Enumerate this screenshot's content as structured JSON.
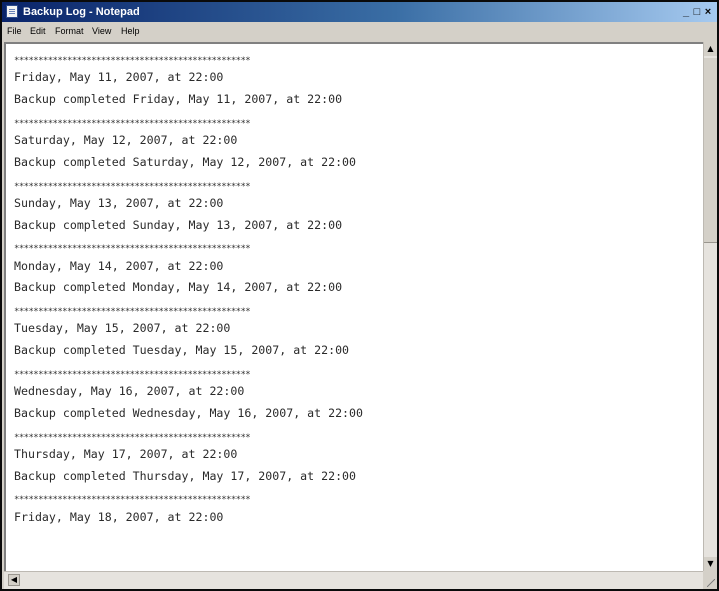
{
  "window": {
    "title": "Backup Log - Notepad",
    "minimize_label": "_",
    "maximize_label": "□",
    "close_label": "×"
  },
  "menu": {
    "items": [
      {
        "label": "File"
      },
      {
        "label": "Edit"
      },
      {
        "label": "Format"
      },
      {
        "label": "View"
      },
      {
        "label": "Help"
      }
    ]
  },
  "document": {
    "lines": [
      {
        "kind": "sep",
        "text": "*************************************************"
      },
      {
        "kind": "text",
        "text": "Friday, May 11, 2007, at 22:00"
      },
      {
        "kind": "text",
        "text": "Backup completed Friday, May 11, 2007, at 22:00"
      },
      {
        "kind": "gap",
        "text": ""
      },
      {
        "kind": "sep",
        "text": "*************************************************"
      },
      {
        "kind": "text",
        "text": "Saturday, May 12, 2007, at 22:00"
      },
      {
        "kind": "text",
        "text": "Backup completed Saturday, May 12, 2007, at 22:00"
      },
      {
        "kind": "gap",
        "text": ""
      },
      {
        "kind": "sep",
        "text": "*************************************************"
      },
      {
        "kind": "text",
        "text": "Sunday, May 13, 2007, at 22:00"
      },
      {
        "kind": "text",
        "text": "Backup completed Sunday, May 13, 2007, at 22:00"
      },
      {
        "kind": "gap",
        "text": ""
      },
      {
        "kind": "sep",
        "text": "*************************************************"
      },
      {
        "kind": "text",
        "text": "Monday, May 14, 2007, at 22:00"
      },
      {
        "kind": "text",
        "text": "Backup completed Monday, May 14, 2007, at 22:00"
      },
      {
        "kind": "gap",
        "text": ""
      },
      {
        "kind": "sep",
        "text": "*************************************************"
      },
      {
        "kind": "text",
        "text": "Tuesday, May 15, 2007, at 22:00"
      },
      {
        "kind": "text",
        "text": "Backup completed Tuesday, May 15, 2007, at 22:00"
      },
      {
        "kind": "gap",
        "text": ""
      },
      {
        "kind": "sep",
        "text": "*************************************************"
      },
      {
        "kind": "text",
        "text": "Wednesday, May 16, 2007, at 22:00"
      },
      {
        "kind": "text",
        "text": "Backup completed Wednesday, May 16, 2007, at 22:00"
      },
      {
        "kind": "gap",
        "text": ""
      },
      {
        "kind": "sep",
        "text": "*************************************************"
      },
      {
        "kind": "text",
        "text": "Thursday, May 17, 2007, at 22:00"
      },
      {
        "kind": "text",
        "text": "Backup completed Thursday, May 17, 2007, at 22:00"
      },
      {
        "kind": "gap",
        "text": ""
      },
      {
        "kind": "sep",
        "text": "*************************************************"
      },
      {
        "kind": "text",
        "text": "Friday, May 18, 2007, at 22:00"
      }
    ]
  },
  "scrollbars": {
    "up_arrow": "▲",
    "down_arrow": "▼",
    "left_arrow": "◀"
  },
  "colors": {
    "titlebar_start": "#0a246a",
    "titlebar_end": "#a6caf0",
    "chrome": "#d4d0c8",
    "editor_bg": "#ffffff"
  }
}
